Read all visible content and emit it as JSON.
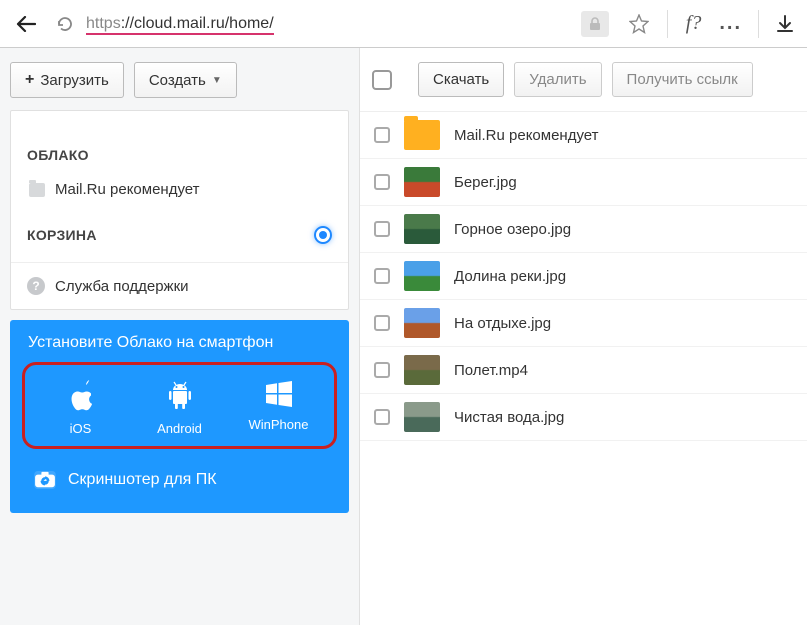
{
  "browser": {
    "url_protocol": "https",
    "url_host": "://cloud.mail.ru/home/",
    "f_label": "f?",
    "dots": "..."
  },
  "toolbar_left": {
    "upload": "Загрузить",
    "create": "Создать"
  },
  "sidebar": {
    "cloud_title": "ОБЛАКО",
    "cloud_item": "Mail.Ru рекомендует",
    "trash_title": "КОРЗИНА",
    "support": "Служба поддержки"
  },
  "promo": {
    "title": "Установите Облако на смартфон",
    "apps": [
      {
        "label": "iOS"
      },
      {
        "label": "Android"
      },
      {
        "label": "WinPhone"
      }
    ],
    "screenshoter": "Скриншотер для ПК"
  },
  "toolbar_right": {
    "download": "Скачать",
    "delete": "Удалить",
    "getlink": "Получить ссылк"
  },
  "files": [
    {
      "name": "Mail.Ru рекомендует",
      "type": "folder",
      "color1": "#ffb020",
      "color2": "#ffb020"
    },
    {
      "name": "Берег.jpg",
      "type": "image",
      "color1": "#3a7a3a",
      "color2": "#c94a2a"
    },
    {
      "name": "Горное озеро.jpg",
      "type": "image",
      "color1": "#4a7a4a",
      "color2": "#2a5a3a"
    },
    {
      "name": "Долина реки.jpg",
      "type": "image",
      "color1": "#4aa0e8",
      "color2": "#3a8a3a"
    },
    {
      "name": "На отдыхе.jpg",
      "type": "image",
      "color1": "#6aa0e8",
      "color2": "#b0582a"
    },
    {
      "name": "Полет.mp4",
      "type": "video",
      "color1": "#7a6a4a",
      "color2": "#5a6a3a"
    },
    {
      "name": "Чистая вода.jpg",
      "type": "image",
      "color1": "#8a9a8a",
      "color2": "#4a6a5a"
    }
  ]
}
